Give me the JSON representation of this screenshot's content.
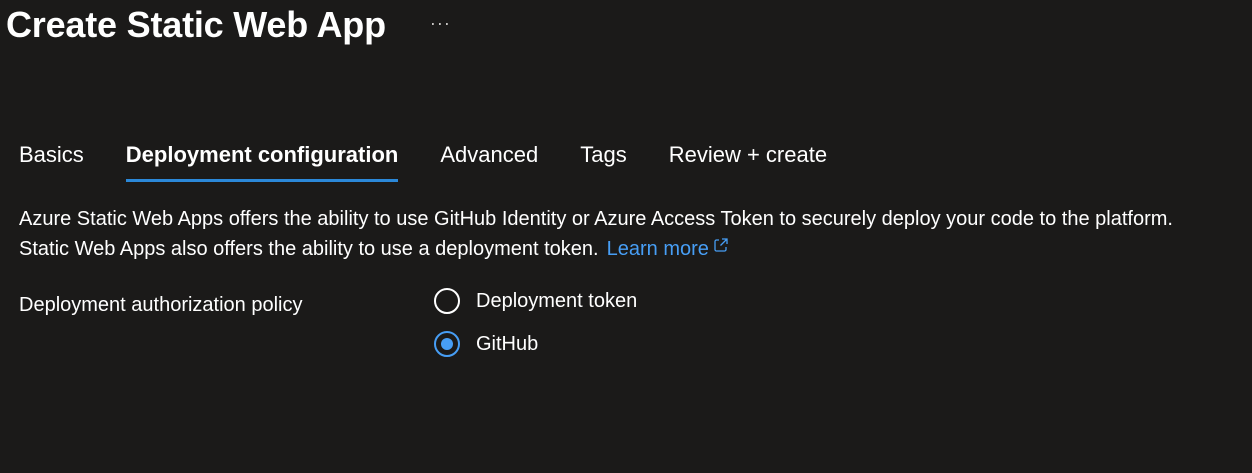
{
  "header": {
    "title": "Create Static Web App",
    "more_label": "···"
  },
  "tabs": [
    {
      "label": "Basics",
      "active": false
    },
    {
      "label": "Deployment configuration",
      "active": true
    },
    {
      "label": "Advanced",
      "active": false
    },
    {
      "label": "Tags",
      "active": false
    },
    {
      "label": "Review + create",
      "active": false
    }
  ],
  "description": {
    "text": "Azure Static Web Apps offers the ability to use GitHub Identity or Azure Access Token to securely deploy your code to the platform. Static Web Apps also offers the ability to use a deployment token.",
    "link_label": "Learn more",
    "link_icon": "external-link-icon"
  },
  "policy": {
    "label": "Deployment authorization policy",
    "options": [
      {
        "label": "Deployment token",
        "selected": false
      },
      {
        "label": "GitHub",
        "selected": true
      }
    ]
  },
  "colors": {
    "background": "#1b1a19",
    "accent": "#479ef5",
    "tab_underline": "#2b88d8"
  }
}
